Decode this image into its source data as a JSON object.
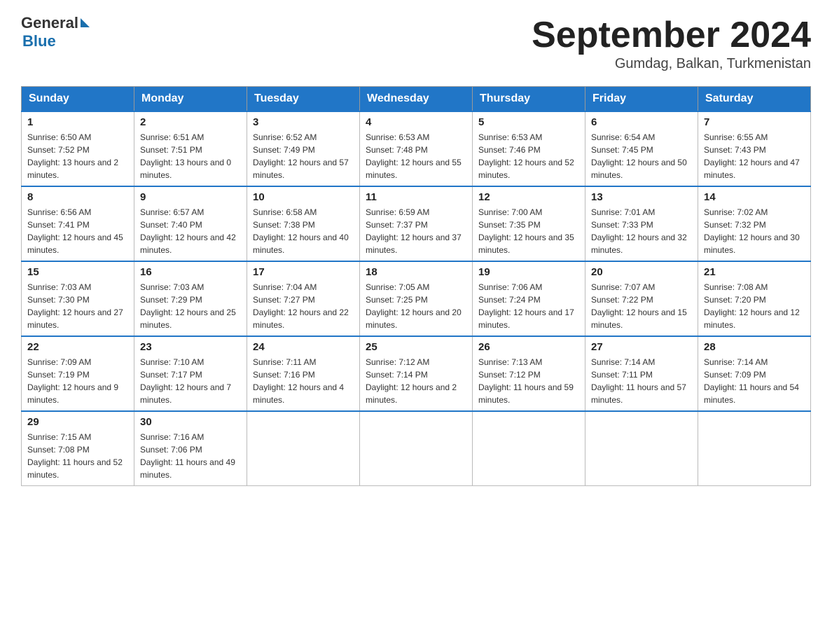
{
  "header": {
    "logo_text1": "General",
    "logo_text2": "Blue",
    "month_title": "September 2024",
    "location": "Gumdag, Balkan, Turkmenistan"
  },
  "weekdays": [
    "Sunday",
    "Monday",
    "Tuesday",
    "Wednesday",
    "Thursday",
    "Friday",
    "Saturday"
  ],
  "weeks": [
    [
      {
        "day": "1",
        "sunrise": "Sunrise: 6:50 AM",
        "sunset": "Sunset: 7:52 PM",
        "daylight": "Daylight: 13 hours and 2 minutes."
      },
      {
        "day": "2",
        "sunrise": "Sunrise: 6:51 AM",
        "sunset": "Sunset: 7:51 PM",
        "daylight": "Daylight: 13 hours and 0 minutes."
      },
      {
        "day": "3",
        "sunrise": "Sunrise: 6:52 AM",
        "sunset": "Sunset: 7:49 PM",
        "daylight": "Daylight: 12 hours and 57 minutes."
      },
      {
        "day": "4",
        "sunrise": "Sunrise: 6:53 AM",
        "sunset": "Sunset: 7:48 PM",
        "daylight": "Daylight: 12 hours and 55 minutes."
      },
      {
        "day": "5",
        "sunrise": "Sunrise: 6:53 AM",
        "sunset": "Sunset: 7:46 PM",
        "daylight": "Daylight: 12 hours and 52 minutes."
      },
      {
        "day": "6",
        "sunrise": "Sunrise: 6:54 AM",
        "sunset": "Sunset: 7:45 PM",
        "daylight": "Daylight: 12 hours and 50 minutes."
      },
      {
        "day": "7",
        "sunrise": "Sunrise: 6:55 AM",
        "sunset": "Sunset: 7:43 PM",
        "daylight": "Daylight: 12 hours and 47 minutes."
      }
    ],
    [
      {
        "day": "8",
        "sunrise": "Sunrise: 6:56 AM",
        "sunset": "Sunset: 7:41 PM",
        "daylight": "Daylight: 12 hours and 45 minutes."
      },
      {
        "day": "9",
        "sunrise": "Sunrise: 6:57 AM",
        "sunset": "Sunset: 7:40 PM",
        "daylight": "Daylight: 12 hours and 42 minutes."
      },
      {
        "day": "10",
        "sunrise": "Sunrise: 6:58 AM",
        "sunset": "Sunset: 7:38 PM",
        "daylight": "Daylight: 12 hours and 40 minutes."
      },
      {
        "day": "11",
        "sunrise": "Sunrise: 6:59 AM",
        "sunset": "Sunset: 7:37 PM",
        "daylight": "Daylight: 12 hours and 37 minutes."
      },
      {
        "day": "12",
        "sunrise": "Sunrise: 7:00 AM",
        "sunset": "Sunset: 7:35 PM",
        "daylight": "Daylight: 12 hours and 35 minutes."
      },
      {
        "day": "13",
        "sunrise": "Sunrise: 7:01 AM",
        "sunset": "Sunset: 7:33 PM",
        "daylight": "Daylight: 12 hours and 32 minutes."
      },
      {
        "day": "14",
        "sunrise": "Sunrise: 7:02 AM",
        "sunset": "Sunset: 7:32 PM",
        "daylight": "Daylight: 12 hours and 30 minutes."
      }
    ],
    [
      {
        "day": "15",
        "sunrise": "Sunrise: 7:03 AM",
        "sunset": "Sunset: 7:30 PM",
        "daylight": "Daylight: 12 hours and 27 minutes."
      },
      {
        "day": "16",
        "sunrise": "Sunrise: 7:03 AM",
        "sunset": "Sunset: 7:29 PM",
        "daylight": "Daylight: 12 hours and 25 minutes."
      },
      {
        "day": "17",
        "sunrise": "Sunrise: 7:04 AM",
        "sunset": "Sunset: 7:27 PM",
        "daylight": "Daylight: 12 hours and 22 minutes."
      },
      {
        "day": "18",
        "sunrise": "Sunrise: 7:05 AM",
        "sunset": "Sunset: 7:25 PM",
        "daylight": "Daylight: 12 hours and 20 minutes."
      },
      {
        "day": "19",
        "sunrise": "Sunrise: 7:06 AM",
        "sunset": "Sunset: 7:24 PM",
        "daylight": "Daylight: 12 hours and 17 minutes."
      },
      {
        "day": "20",
        "sunrise": "Sunrise: 7:07 AM",
        "sunset": "Sunset: 7:22 PM",
        "daylight": "Daylight: 12 hours and 15 minutes."
      },
      {
        "day": "21",
        "sunrise": "Sunrise: 7:08 AM",
        "sunset": "Sunset: 7:20 PM",
        "daylight": "Daylight: 12 hours and 12 minutes."
      }
    ],
    [
      {
        "day": "22",
        "sunrise": "Sunrise: 7:09 AM",
        "sunset": "Sunset: 7:19 PM",
        "daylight": "Daylight: 12 hours and 9 minutes."
      },
      {
        "day": "23",
        "sunrise": "Sunrise: 7:10 AM",
        "sunset": "Sunset: 7:17 PM",
        "daylight": "Daylight: 12 hours and 7 minutes."
      },
      {
        "day": "24",
        "sunrise": "Sunrise: 7:11 AM",
        "sunset": "Sunset: 7:16 PM",
        "daylight": "Daylight: 12 hours and 4 minutes."
      },
      {
        "day": "25",
        "sunrise": "Sunrise: 7:12 AM",
        "sunset": "Sunset: 7:14 PM",
        "daylight": "Daylight: 12 hours and 2 minutes."
      },
      {
        "day": "26",
        "sunrise": "Sunrise: 7:13 AM",
        "sunset": "Sunset: 7:12 PM",
        "daylight": "Daylight: 11 hours and 59 minutes."
      },
      {
        "day": "27",
        "sunrise": "Sunrise: 7:14 AM",
        "sunset": "Sunset: 7:11 PM",
        "daylight": "Daylight: 11 hours and 57 minutes."
      },
      {
        "day": "28",
        "sunrise": "Sunrise: 7:14 AM",
        "sunset": "Sunset: 7:09 PM",
        "daylight": "Daylight: 11 hours and 54 minutes."
      }
    ],
    [
      {
        "day": "29",
        "sunrise": "Sunrise: 7:15 AM",
        "sunset": "Sunset: 7:08 PM",
        "daylight": "Daylight: 11 hours and 52 minutes."
      },
      {
        "day": "30",
        "sunrise": "Sunrise: 7:16 AM",
        "sunset": "Sunset: 7:06 PM",
        "daylight": "Daylight: 11 hours and 49 minutes."
      },
      null,
      null,
      null,
      null,
      null
    ]
  ]
}
